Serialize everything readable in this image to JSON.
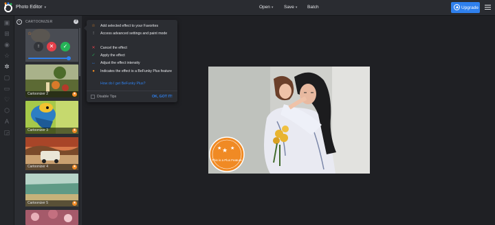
{
  "header": {
    "app_title": "Photo Editor",
    "menu": {
      "open": "Open",
      "save": "Save",
      "batch": "Batch"
    },
    "upgrade_label": "Upgrade",
    "accent_color": "#2f80ed"
  },
  "panel": {
    "title": "CARTOONIZER",
    "thumbnails": [
      {
        "label": "Cartoonizer 2"
      },
      {
        "label": "Cartoonizer 3"
      },
      {
        "label": "Cartoonizer 4"
      },
      {
        "label": "Cartoonizer 5"
      }
    ],
    "active_effect": {
      "intensity": 0.95
    }
  },
  "tips": {
    "items": [
      {
        "icon": "star-icon",
        "text": "Add selected effect to your Favorites"
      },
      {
        "icon": "settings-icon",
        "text": "Access advanced settings and paint mode"
      },
      {
        "icon": "close-icon",
        "text": "Cancel the effect"
      },
      {
        "icon": "check-icon",
        "text": "Apply the effect"
      },
      {
        "icon": "arrows-icon",
        "text": "Adjust the effect intensity"
      },
      {
        "icon": "plus-badge-icon",
        "text": "Indicates the effect is a BeFunky Plus feature"
      }
    ],
    "link": "How do I get BeFunky Plus?",
    "disable_label": "Disable Tips",
    "got_it_label": "OK, GOT IT!"
  },
  "canvas": {
    "plus_badge": "This is a Plus Feature"
  },
  "colors": {
    "plus_orange": "#f08a24",
    "cancel_red": "#e5404a",
    "apply_green": "#26b357"
  }
}
